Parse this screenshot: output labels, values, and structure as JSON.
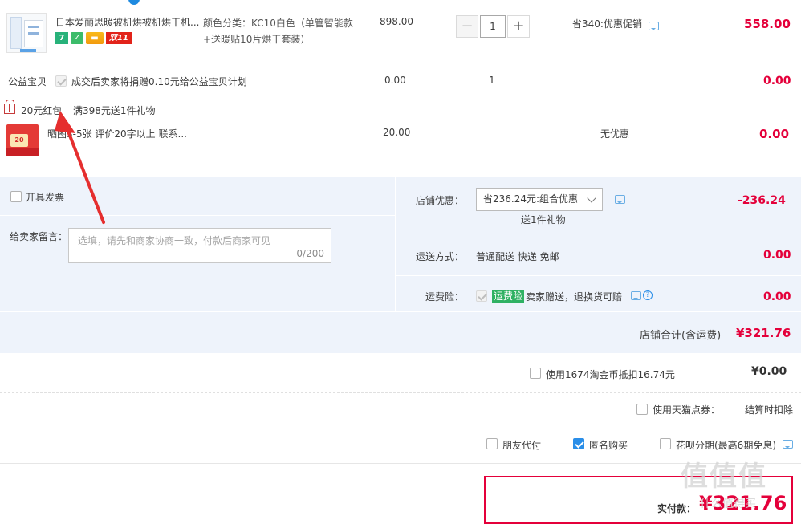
{
  "product": {
    "title": "日本爱丽思暖被机烘被机烘干机...",
    "badges": [
      "7",
      "",
      "",
      "双11"
    ],
    "spec": "颜色分类：KC10白色（单管智能款+送暖贴10片烘干套装）",
    "unit_price": "898.00",
    "quantity": "1",
    "promo": "省340:优惠促销",
    "subtotal": "558.00"
  },
  "charity": {
    "label": "公益宝贝",
    "text": "成交后卖家将捐赠0.10元给公益宝贝计划",
    "price": "0.00",
    "qty": "1",
    "subtotal": "0.00"
  },
  "gift": {
    "tag": "20元红包",
    "condition": "满398元送1件礼物",
    "title": "晒图3-5张 评价20字以上 联系...",
    "price": "20.00",
    "promo": "无优惠",
    "subtotal": "0.00",
    "thumb_text": "20"
  },
  "order": {
    "invoice_label": "开具发票",
    "message_label": "给卖家留言：",
    "message_placeholder": "选填，请先和商家协商一致，付款后商家可见",
    "message_count": "0/200",
    "shop_discount_label": "店铺优惠：",
    "shop_discount_value": "省236.24元:组合优惠",
    "shop_discount_note": "送1件礼物",
    "shop_discount_amount": "-236.24",
    "shipping_label": "运送方式：",
    "shipping_value": "普通配送 快递 免邮",
    "shipping_amount": "0.00",
    "insurance_label": "运费险：",
    "insurance_tag": "运费险",
    "insurance_text": "卖家赠送，退换货可赔",
    "insurance_amount": "0.00",
    "shop_total_label": "店铺合计(含运费)",
    "shop_total": "¥321.76"
  },
  "payment": {
    "coins_text": "使用1674淘金币抵扣16.74元",
    "coins_amount": "¥0.00",
    "tmall_points": "使用天猫点券：",
    "tmall_points_note": "结算时扣除",
    "friend_pay": "朋友代付",
    "anonymous": "匿名购买",
    "huabei": "花呗分期(最高6期免息)",
    "actual_label": "实付款：",
    "actual_amount": "¥321.76"
  },
  "watermark": {
    "text": "值值值",
    "sub": "什么值得买"
  },
  "colors": {
    "accent_red": "#e4003a",
    "link_blue": "#2a8ee8",
    "panel_bg": "#eef3fb",
    "green": "#2fb163"
  }
}
